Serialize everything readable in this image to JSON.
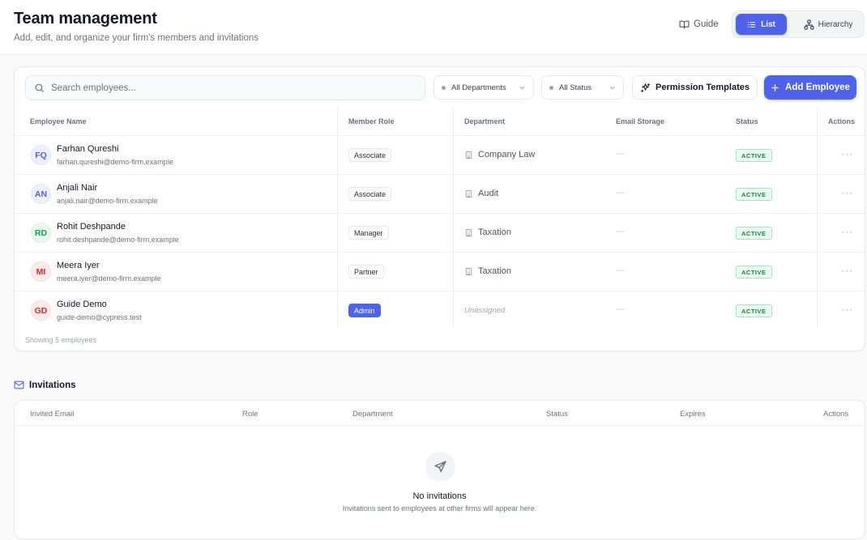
{
  "header": {
    "title": "Team management",
    "subtitle": "Add, edit, and organize your firm's members and invitations",
    "guide_label": "Guide",
    "view_list_label": "List",
    "view_hierarchy_label": "Hierarchy",
    "active_view": "List"
  },
  "toolbar": {
    "search_placeholder": "Search employees...",
    "search_value": "",
    "department_filter": "All Departments",
    "status_filter": "All Status",
    "permission_templates_label": "Permission Templates",
    "add_employee_label": "Add Employee"
  },
  "employees": {
    "columns": [
      "Employee Name",
      "Member Role",
      "Department",
      "Email Storage",
      "Status",
      "Actions"
    ],
    "rows": [
      {
        "initials": "FQ",
        "name": "Farhan Qureshi",
        "email": "farhan.qureshi@demo-firm.example",
        "role": "Associate",
        "department": "Company Law",
        "storage": "—",
        "status": "ACTIVE",
        "actions": "···"
      },
      {
        "initials": "AN",
        "name": "Anjali Nair",
        "email": "anjali.nair@demo-firm.example",
        "role": "Associate",
        "department": "Audit",
        "storage": "—",
        "status": "ACTIVE",
        "actions": "···"
      },
      {
        "initials": "RD",
        "name": "Rohit Deshpande",
        "email": "rohit.deshpande@demo-firm.example",
        "role": "Manager",
        "department": "Taxation",
        "storage": "—",
        "status": "ACTIVE",
        "actions": "···"
      },
      {
        "initials": "MI",
        "name": "Meera Iyer",
        "email": "meera.iyer@demo-firm.example",
        "role": "Partner",
        "department": "Taxation",
        "storage": "—",
        "status": "ACTIVE",
        "actions": "···"
      },
      {
        "initials": "GD",
        "name": "Guide Demo",
        "email": "guide-demo@cypress.test",
        "role": "Admin",
        "department": "Unassigned",
        "storage": "—",
        "status": "ACTIVE",
        "actions": "···"
      }
    ],
    "footer": "Showing 5 employees"
  },
  "invitations": {
    "heading": "Invitations",
    "columns": [
      "Invited Email",
      "Role",
      "Department",
      "Status",
      "Expires",
      "Actions"
    ],
    "empty_title": "No invitations",
    "empty_description": "Invitations sent to employees at other firms will appear here."
  },
  "colors": {
    "accent": "#4f63ea",
    "active_badge_bg": "#ecfdf3",
    "active_badge_text": "#15803d"
  },
  "icons": {
    "guide": "book-open-icon",
    "list": "list-icon",
    "hierarchy": "hierarchy-icon",
    "search": "search-icon",
    "chevron": "chevron-down-icon",
    "permission": "sparkles-icon",
    "add": "plus-icon",
    "department": "building-icon",
    "invitations": "mail-icon",
    "empty_state": "send-icon"
  }
}
